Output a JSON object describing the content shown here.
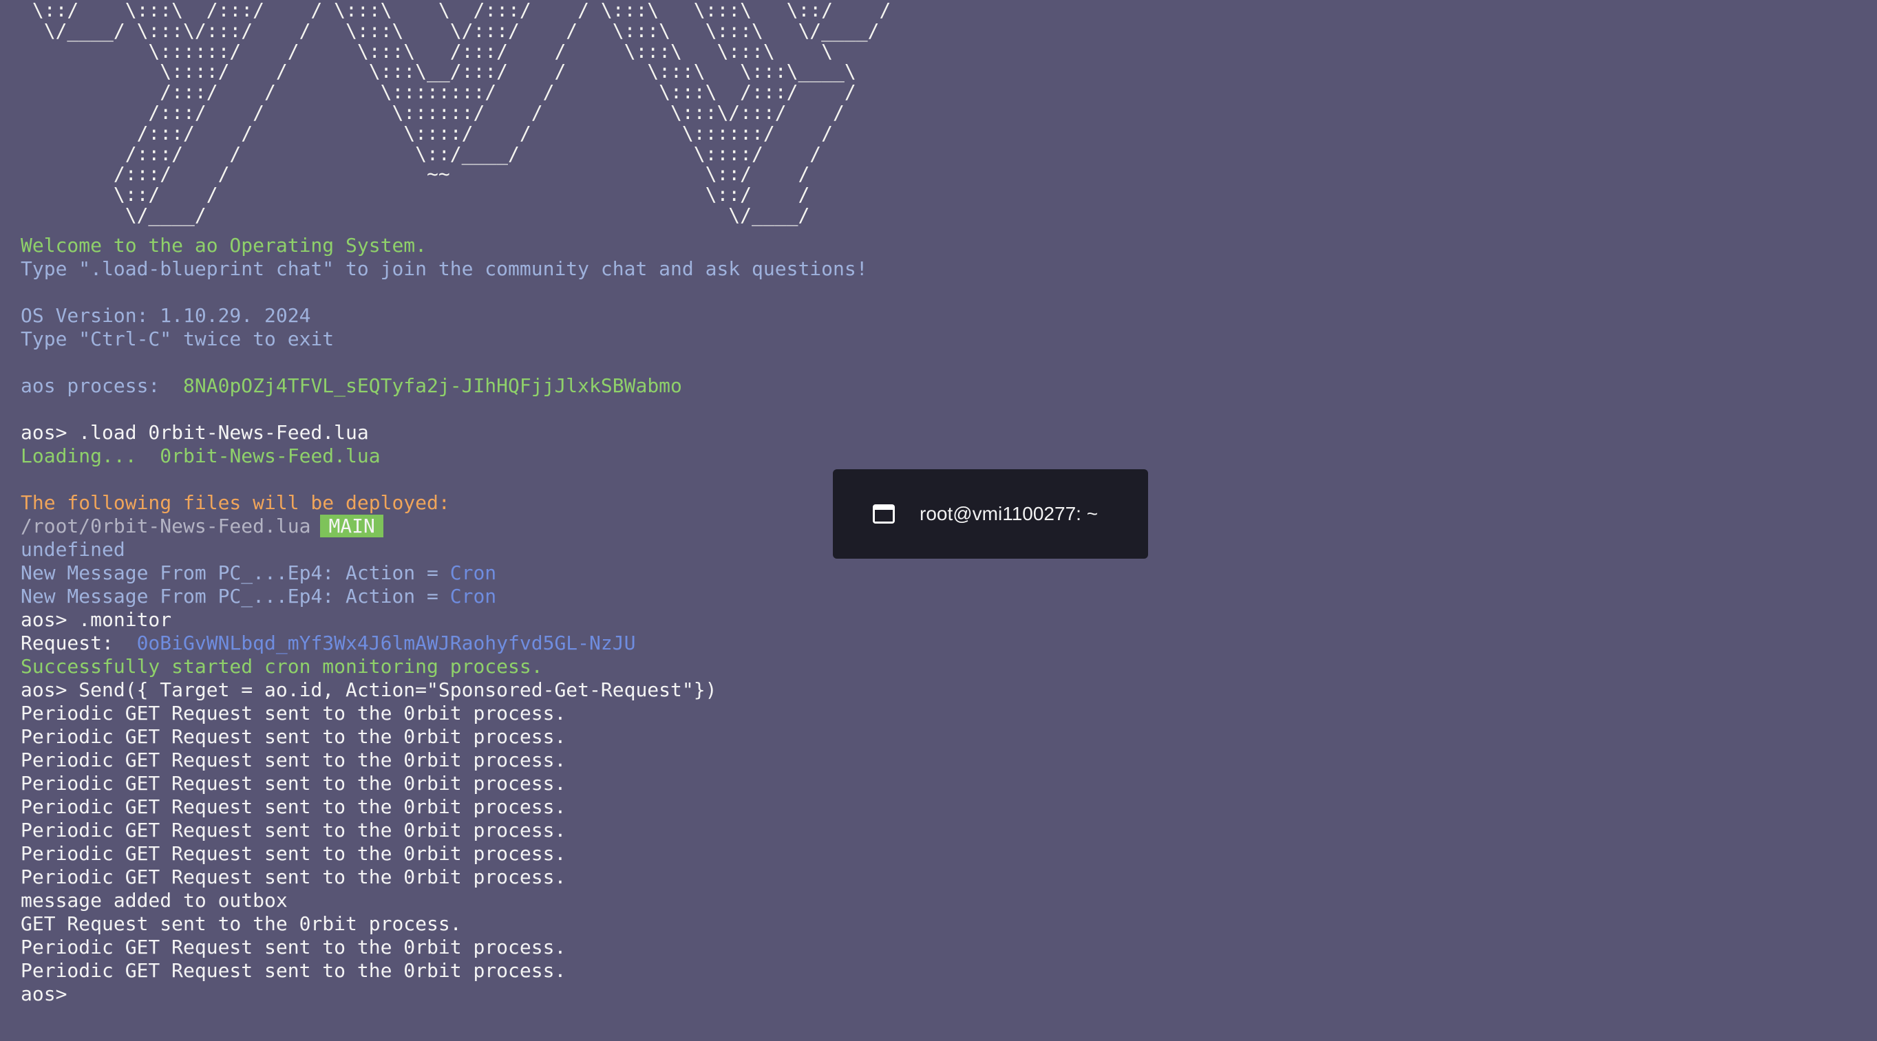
{
  "terminal": {
    "ascii_art": " \\::/    \\:::\\  /:::/    / \\:::\\    \\  /:::/    / \\:::\\   \\:::\\   \\::/    /\n  \\/____/ \\:::\\/:::/    /   \\:::\\    \\/:::/    /   \\:::\\   \\:::\\   \\/____/\n           \\::::::/    /     \\:::\\   /:::/    /     \\:::\\   \\:::\\    \\\n            \\::::/    /       \\:::\\__/:::/    /       \\:::\\   \\:::\\____\\\n            /:::/    /         \\::::::::/    /         \\:::\\  /:::/    /\n           /:::/    /           \\::::::/    /           \\:::\\/:::/    /\n          /:::/    /             \\::::/    /             \\::::::/    /\n         /:::/    /               \\::/____/               \\::::/    /\n        /:::/    /                 ~~                      \\::/    /\n        \\::/    /                                          \\::/    /\n         \\/____/                                             \\/____/",
    "welcome": "Welcome to the ao Operating System.",
    "blueprint_hint": "Type \".load-blueprint chat\" to join the community chat and ask questions!",
    "os_version": "OS Version: 1.10.29. 2024",
    "exit_hint": "Type \"Ctrl-C\" twice to exit",
    "process_label": "aos process:",
    "process_id": "8NA0pOZj4TFVL_sEQTyfa2j-JIhHQFjjJlxkSBWabmo",
    "cmd_load": "aos> .load 0rbit-News-Feed.lua",
    "loading_label": "Loading...",
    "loading_file": "0rbit-News-Feed.lua",
    "deploy_heading": "The following files will be deployed:",
    "deploy_path": "/root/0rbit-News-Feed.lua",
    "deploy_badge": "MAIN",
    "undefined": "undefined",
    "messages": [
      {
        "prefix": "New Message From ",
        "from": "PC_...Ep4",
        "sep": ": Action = ",
        "action": "Cron"
      },
      {
        "prefix": "New Message From ",
        "from": "PC_...Ep4",
        "sep": ": Action = ",
        "action": "Cron"
      }
    ],
    "cmd_monitor": "aos> .monitor",
    "request_label": "Request:",
    "request_id": "0oBiGvWNLbqd_mYf3Wx4J6lmAWJRaohyfvd5GL-NzJU",
    "monitor_success": "Successfully started cron monitoring process.",
    "cmd_send": "aos> Send({ Target = ao.id, Action=\"Sponsored-Get-Request\"})",
    "output_lines": [
      "Periodic GET Request sent to the 0rbit process.",
      "Periodic GET Request sent to the 0rbit process.",
      "Periodic GET Request sent to the 0rbit process.",
      "Periodic GET Request sent to the 0rbit process.",
      "Periodic GET Request sent to the 0rbit process.",
      "Periodic GET Request sent to the 0rbit process.",
      "Periodic GET Request sent to the 0rbit process.",
      "Periodic GET Request sent to the 0rbit process.",
      "message added to outbox",
      "GET Request sent to the 0rbit process.",
      "Periodic GET Request sent to the 0rbit process.",
      "Periodic GET Request sent to the 0rbit process."
    ],
    "prompt": "aos>"
  },
  "tooltip": {
    "icon": "terminal-window-icon",
    "title": "root@vmi1100277: ~"
  },
  "colors": {
    "background": "#585574",
    "green": "#8fd16a",
    "blue": "#9fb2dd",
    "orange": "#f0a55a",
    "link_blue": "#6f8de0",
    "badge_green": "#7ec35a",
    "tooltip_bg": "#1c1c26"
  }
}
